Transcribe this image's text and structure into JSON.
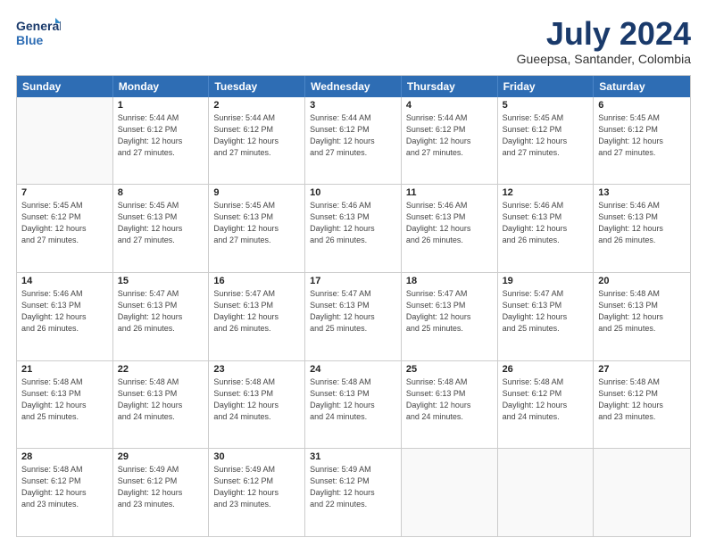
{
  "logo": {
    "line1": "General",
    "line2": "Blue"
  },
  "title": "July 2024",
  "location": "Gueepsa, Santander, Colombia",
  "days_of_week": [
    "Sunday",
    "Monday",
    "Tuesday",
    "Wednesday",
    "Thursday",
    "Friday",
    "Saturday"
  ],
  "weeks": [
    [
      {
        "day": "",
        "info": ""
      },
      {
        "day": "1",
        "info": "Sunrise: 5:44 AM\nSunset: 6:12 PM\nDaylight: 12 hours\nand 27 minutes."
      },
      {
        "day": "2",
        "info": "Sunrise: 5:44 AM\nSunset: 6:12 PM\nDaylight: 12 hours\nand 27 minutes."
      },
      {
        "day": "3",
        "info": "Sunrise: 5:44 AM\nSunset: 6:12 PM\nDaylight: 12 hours\nand 27 minutes."
      },
      {
        "day": "4",
        "info": "Sunrise: 5:44 AM\nSunset: 6:12 PM\nDaylight: 12 hours\nand 27 minutes."
      },
      {
        "day": "5",
        "info": "Sunrise: 5:45 AM\nSunset: 6:12 PM\nDaylight: 12 hours\nand 27 minutes."
      },
      {
        "day": "6",
        "info": "Sunrise: 5:45 AM\nSunset: 6:12 PM\nDaylight: 12 hours\nand 27 minutes."
      }
    ],
    [
      {
        "day": "7",
        "info": "Sunrise: 5:45 AM\nSunset: 6:12 PM\nDaylight: 12 hours\nand 27 minutes."
      },
      {
        "day": "8",
        "info": "Sunrise: 5:45 AM\nSunset: 6:13 PM\nDaylight: 12 hours\nand 27 minutes."
      },
      {
        "day": "9",
        "info": "Sunrise: 5:45 AM\nSunset: 6:13 PM\nDaylight: 12 hours\nand 27 minutes."
      },
      {
        "day": "10",
        "info": "Sunrise: 5:46 AM\nSunset: 6:13 PM\nDaylight: 12 hours\nand 26 minutes."
      },
      {
        "day": "11",
        "info": "Sunrise: 5:46 AM\nSunset: 6:13 PM\nDaylight: 12 hours\nand 26 minutes."
      },
      {
        "day": "12",
        "info": "Sunrise: 5:46 AM\nSunset: 6:13 PM\nDaylight: 12 hours\nand 26 minutes."
      },
      {
        "day": "13",
        "info": "Sunrise: 5:46 AM\nSunset: 6:13 PM\nDaylight: 12 hours\nand 26 minutes."
      }
    ],
    [
      {
        "day": "14",
        "info": "Sunrise: 5:46 AM\nSunset: 6:13 PM\nDaylight: 12 hours\nand 26 minutes."
      },
      {
        "day": "15",
        "info": "Sunrise: 5:47 AM\nSunset: 6:13 PM\nDaylight: 12 hours\nand 26 minutes."
      },
      {
        "day": "16",
        "info": "Sunrise: 5:47 AM\nSunset: 6:13 PM\nDaylight: 12 hours\nand 26 minutes."
      },
      {
        "day": "17",
        "info": "Sunrise: 5:47 AM\nSunset: 6:13 PM\nDaylight: 12 hours\nand 25 minutes."
      },
      {
        "day": "18",
        "info": "Sunrise: 5:47 AM\nSunset: 6:13 PM\nDaylight: 12 hours\nand 25 minutes."
      },
      {
        "day": "19",
        "info": "Sunrise: 5:47 AM\nSunset: 6:13 PM\nDaylight: 12 hours\nand 25 minutes."
      },
      {
        "day": "20",
        "info": "Sunrise: 5:48 AM\nSunset: 6:13 PM\nDaylight: 12 hours\nand 25 minutes."
      }
    ],
    [
      {
        "day": "21",
        "info": "Sunrise: 5:48 AM\nSunset: 6:13 PM\nDaylight: 12 hours\nand 25 minutes."
      },
      {
        "day": "22",
        "info": "Sunrise: 5:48 AM\nSunset: 6:13 PM\nDaylight: 12 hours\nand 24 minutes."
      },
      {
        "day": "23",
        "info": "Sunrise: 5:48 AM\nSunset: 6:13 PM\nDaylight: 12 hours\nand 24 minutes."
      },
      {
        "day": "24",
        "info": "Sunrise: 5:48 AM\nSunset: 6:13 PM\nDaylight: 12 hours\nand 24 minutes."
      },
      {
        "day": "25",
        "info": "Sunrise: 5:48 AM\nSunset: 6:13 PM\nDaylight: 12 hours\nand 24 minutes."
      },
      {
        "day": "26",
        "info": "Sunrise: 5:48 AM\nSunset: 6:12 PM\nDaylight: 12 hours\nand 24 minutes."
      },
      {
        "day": "27",
        "info": "Sunrise: 5:48 AM\nSunset: 6:12 PM\nDaylight: 12 hours\nand 23 minutes."
      }
    ],
    [
      {
        "day": "28",
        "info": "Sunrise: 5:48 AM\nSunset: 6:12 PM\nDaylight: 12 hours\nand 23 minutes."
      },
      {
        "day": "29",
        "info": "Sunrise: 5:49 AM\nSunset: 6:12 PM\nDaylight: 12 hours\nand 23 minutes."
      },
      {
        "day": "30",
        "info": "Sunrise: 5:49 AM\nSunset: 6:12 PM\nDaylight: 12 hours\nand 23 minutes."
      },
      {
        "day": "31",
        "info": "Sunrise: 5:49 AM\nSunset: 6:12 PM\nDaylight: 12 hours\nand 22 minutes."
      },
      {
        "day": "",
        "info": ""
      },
      {
        "day": "",
        "info": ""
      },
      {
        "day": "",
        "info": ""
      }
    ]
  ]
}
